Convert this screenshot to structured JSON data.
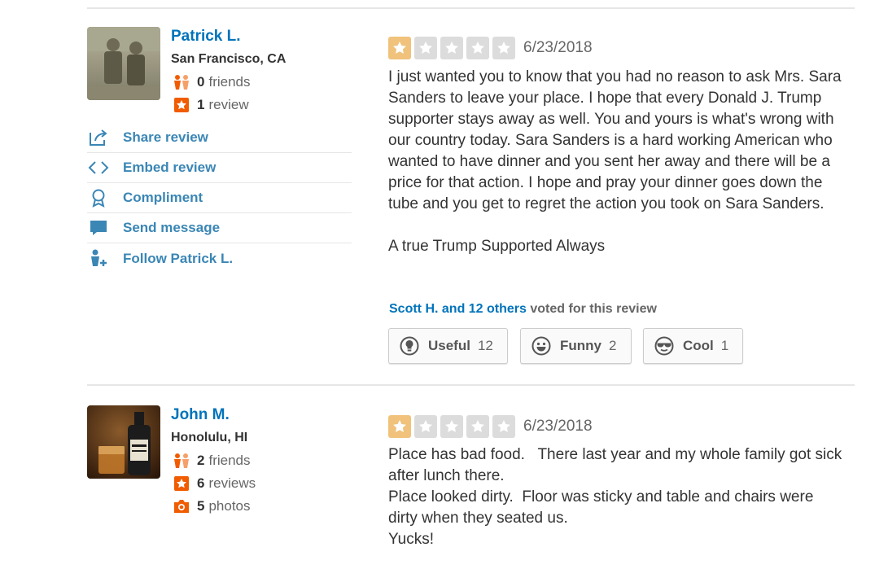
{
  "colors": {
    "link": "#0073bb",
    "action_link": "#3a86b5",
    "star_on": "#f0c27b",
    "star_off": "#dcdcdc",
    "icon_orange": "#f15c00"
  },
  "reviews": [
    {
      "user": {
        "name": "Patrick L.",
        "location": "San Francisco, CA",
        "friends_count": "0",
        "friends_label": "friends",
        "reviews_count": "1",
        "reviews_label": "review"
      },
      "actions": [
        {
          "icon": "share-icon",
          "label": "Share review"
        },
        {
          "icon": "embed-icon",
          "label": "Embed review"
        },
        {
          "icon": "compliment-icon",
          "label": "Compliment"
        },
        {
          "icon": "message-icon",
          "label": "Send message"
        },
        {
          "icon": "follow-icon",
          "label": "Follow Patrick L."
        }
      ],
      "rating": 1,
      "date": "6/23/2018",
      "text": [
        "I just wanted you to know that you had no reason to ask Mrs. Sara Sanders to leave your place. I hope that every Donald J. Trump supporter stays away as well. You and yours is what's wrong with our country today. Sara Sanders is a hard working American who wanted to have dinner and you sent her away and there will be a price for that action. I hope and pray your dinner goes down the tube and you get to regret the action you took on Sara Sanders.",
        "A true Trump Supported Always"
      ],
      "voted_by": "Scott H. and 12 others",
      "voted_suffix": " voted for this review",
      "votes": [
        {
          "icon": "useful-icon",
          "label": "Useful",
          "count": "12"
        },
        {
          "icon": "funny-icon",
          "label": "Funny",
          "count": "2"
        },
        {
          "icon": "cool-icon",
          "label": "Cool",
          "count": "1"
        }
      ]
    },
    {
      "user": {
        "name": "John M.",
        "location": "Honolulu, HI",
        "friends_count": "2",
        "friends_label": "friends",
        "reviews_count": "6",
        "reviews_label": "reviews",
        "photos_count": "5",
        "photos_label": "photos"
      },
      "rating": 1,
      "date": "6/23/2018",
      "text": [
        "Place has bad food.   There last year and my whole family got sick after lunch there.",
        "Place looked dirty.  Floor was sticky and table and chairs were dirty when they seated us.",
        "Yucks!"
      ]
    }
  ]
}
